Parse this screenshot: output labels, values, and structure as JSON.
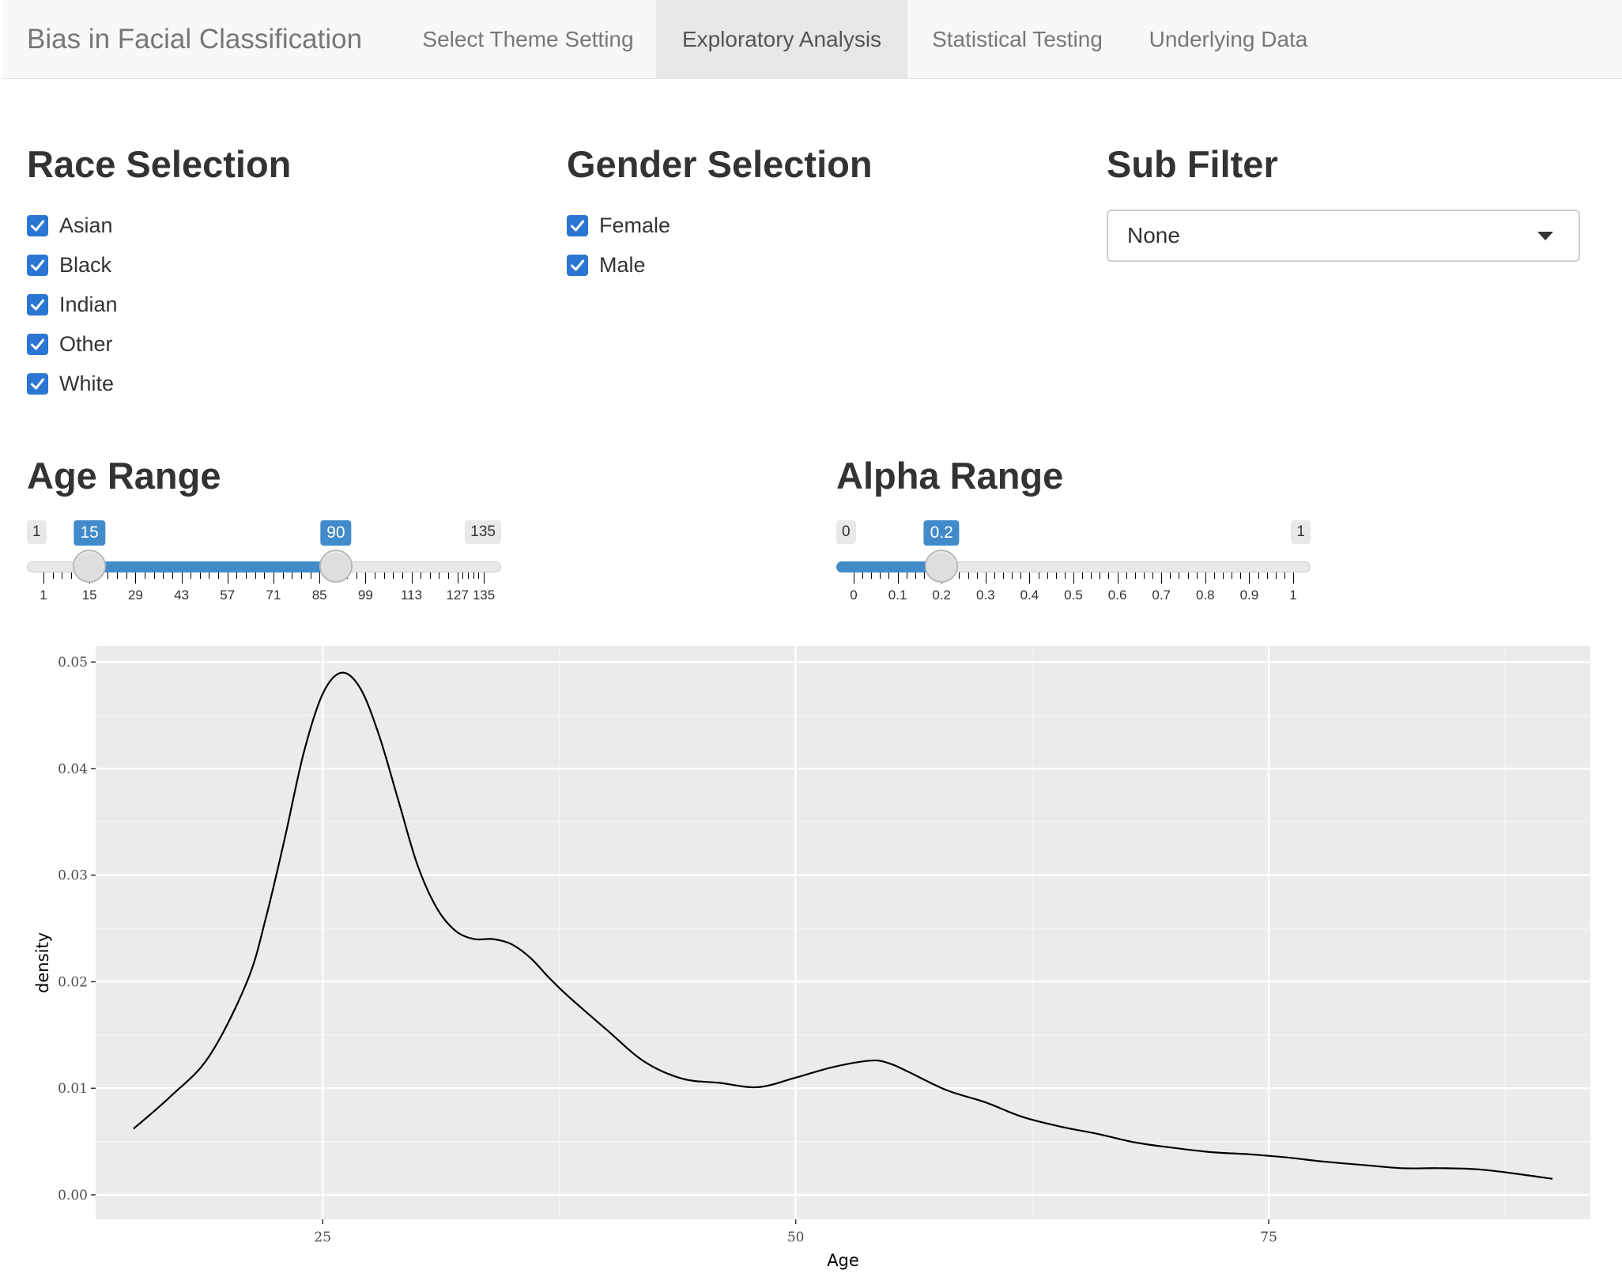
{
  "navbar": {
    "brand": "Bias in Facial Classification",
    "tabs": [
      {
        "label": "Select Theme Setting",
        "active": false
      },
      {
        "label": "Exploratory Analysis",
        "active": true
      },
      {
        "label": "Statistical Testing",
        "active": false
      },
      {
        "label": "Underlying Data",
        "active": false
      }
    ]
  },
  "race": {
    "title": "Race Selection",
    "options": [
      {
        "label": "Asian",
        "checked": true
      },
      {
        "label": "Black",
        "checked": true
      },
      {
        "label": "Indian",
        "checked": true
      },
      {
        "label": "Other",
        "checked": true
      },
      {
        "label": "White",
        "checked": true
      }
    ]
  },
  "gender": {
    "title": "Gender Selection",
    "options": [
      {
        "label": "Female",
        "checked": true
      },
      {
        "label": "Male",
        "checked": true
      }
    ]
  },
  "subfilter": {
    "title": "Sub Filter",
    "selected": "None"
  },
  "age_range": {
    "title": "Age Range",
    "min_label": "1",
    "max_label": "135",
    "from_label": "15",
    "to_label": "90",
    "min": 1,
    "max": 135,
    "from": 15,
    "to": 90,
    "tick_labels": [
      "1",
      "15",
      "29",
      "43",
      "57",
      "71",
      "85",
      "99",
      "113",
      "127",
      "135"
    ]
  },
  "alpha_range": {
    "title": "Alpha Range",
    "min_label": "0",
    "max_label": "1",
    "value_label": "0.2",
    "min": 0,
    "max": 1,
    "value": 0.2,
    "tick_labels": [
      "0",
      "0.1",
      "0.2",
      "0.3",
      "0.4",
      "0.5",
      "0.6",
      "0.7",
      "0.8",
      "0.9",
      "1"
    ]
  },
  "colors": {
    "checkbox": "#2a76d2",
    "slider_accent": "#428bca",
    "plot_panel": "#ebebeb"
  },
  "chart_data": {
    "type": "line",
    "xlabel": "Age",
    "ylabel": "density",
    "xlim": [
      13,
      92
    ],
    "ylim": [
      -0.0023,
      0.0515
    ],
    "x_ticks": [
      25,
      50,
      75
    ],
    "y_ticks": [
      0.0,
      0.01,
      0.02,
      0.03,
      0.04,
      0.05
    ],
    "x_tick_labels": [
      "25",
      "50",
      "75"
    ],
    "y_tick_labels": [
      "0.00",
      "0.01",
      "0.02",
      "0.03",
      "0.04",
      "0.05"
    ],
    "grid": true,
    "series": [
      {
        "x": [
          15,
          17,
          19,
          21,
          22,
          23,
          24,
          25,
          26,
          27,
          28,
          29,
          30,
          31,
          32,
          33,
          34,
          35,
          36,
          37,
          38,
          40,
          42,
          44,
          46,
          48,
          50,
          52,
          54,
          55,
          56,
          58,
          60,
          62,
          64,
          66,
          68,
          70,
          72,
          74,
          76,
          78,
          80,
          82,
          84,
          86,
          88,
          90
        ],
        "y": [
          0.0062,
          0.0093,
          0.013,
          0.02,
          0.026,
          0.0335,
          0.0415,
          0.047,
          0.049,
          0.0475,
          0.043,
          0.037,
          0.031,
          0.027,
          0.0248,
          0.024,
          0.024,
          0.0235,
          0.0222,
          0.0203,
          0.0186,
          0.0155,
          0.0125,
          0.0109,
          0.0105,
          0.0101,
          0.011,
          0.012,
          0.0126,
          0.0123,
          0.0115,
          0.0098,
          0.0087,
          0.0073,
          0.0064,
          0.0057,
          0.0049,
          0.0044,
          0.004,
          0.0038,
          0.0035,
          0.0031,
          0.0028,
          0.0025,
          0.0025,
          0.0024,
          0.002,
          0.0015
        ]
      }
    ]
  }
}
